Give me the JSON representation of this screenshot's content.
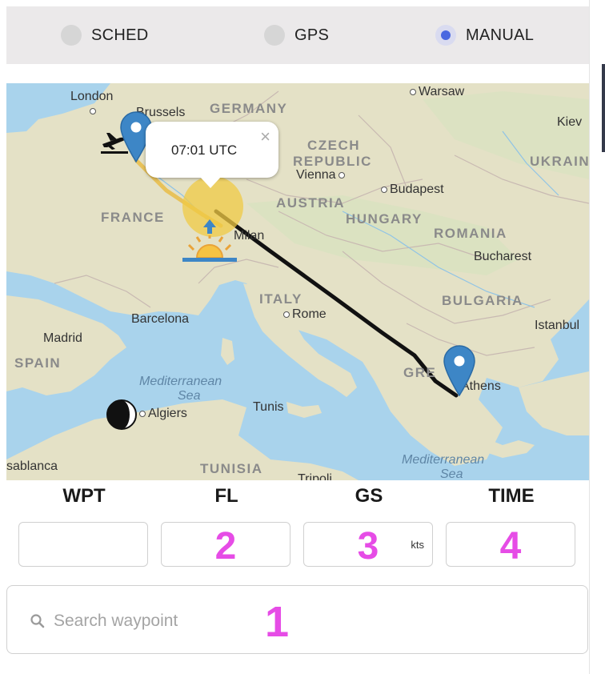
{
  "mode_selector": {
    "options": [
      {
        "label": "SCHED",
        "selected": false
      },
      {
        "label": "GPS",
        "selected": false
      },
      {
        "label": "MANUAL",
        "selected": true
      }
    ],
    "accent_color": "#4a68e0"
  },
  "map": {
    "popup_text": "07:01 UTC",
    "popup_close": "×",
    "labels": {
      "london": "London",
      "brussels": "Brussels",
      "germany": "GERMANY",
      "warsaw": "Warsaw",
      "kiev": "Kiev",
      "czech": "CZECH",
      "republic": "REPUBLIC",
      "vienna": "Vienna",
      "austria": "AUSTRIA",
      "budapest": "Budapest",
      "hungary": "HUNGARY",
      "ukraine": "UKRAIN",
      "france": "FRANCE",
      "milan": "Milan",
      "romania": "ROMANIA",
      "bucharest": "Bucharest",
      "italy": "ITALY",
      "rome": "Rome",
      "bulgaria": "BULGARIA",
      "istanbul": "Istanbul",
      "barcelona": "Barcelona",
      "madrid": "Madrid",
      "spain": "SPAIN",
      "greece": "GRE",
      "athens": "Athens",
      "sea1_line1": "Mediterranean",
      "sea1_line2": "Sea",
      "tunis": "Tunis",
      "algiers": "Algiers",
      "tunisia": "TUNISIA",
      "casablanca": "sablanca",
      "tripoli": "Tripoli",
      "sea2_line1": "Mediterranean",
      "sea2_line2": "Sea"
    },
    "icons": [
      "departure-plane-icon",
      "origin-pin-icon",
      "sunrise-icon",
      "destination-pin-icon",
      "moon-phase-icon"
    ],
    "route_color_flown": "#e8c25a",
    "route_color_remaining": "#111111"
  },
  "columns": {
    "headers": [
      "WPT",
      "FL",
      "GS",
      "TIME"
    ],
    "fields": [
      {
        "marker": ""
      },
      {
        "marker": "2"
      },
      {
        "marker": "3",
        "unit": "kts"
      },
      {
        "marker": "4"
      }
    ]
  },
  "search": {
    "placeholder": "Search waypoint",
    "marker": "1"
  }
}
